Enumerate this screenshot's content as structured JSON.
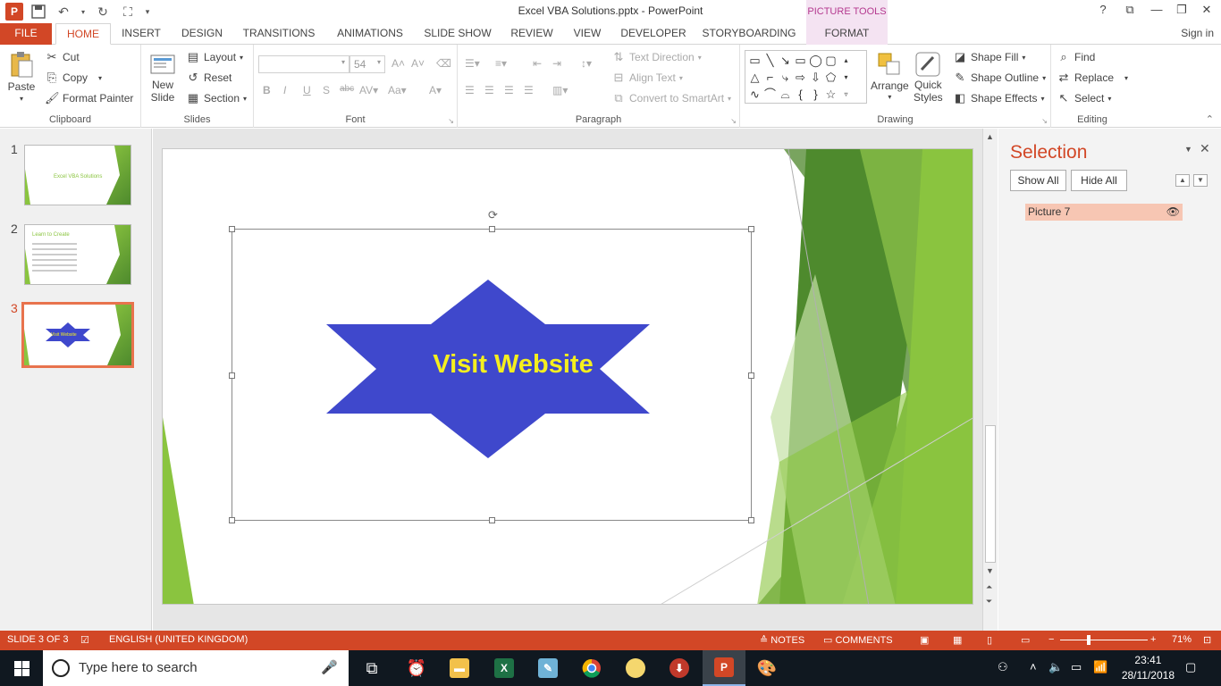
{
  "window": {
    "title": "Excel VBA Solutions.pptx - PowerPoint",
    "context_tab_group": "PICTURE TOOLS",
    "help": "?",
    "minimize": "—",
    "restore": "❐",
    "close": "✕",
    "ribbon_display": "⧉"
  },
  "tabs": [
    "FILE",
    "HOME",
    "INSERT",
    "DESIGN",
    "TRANSITIONS",
    "ANIMATIONS",
    "SLIDE SHOW",
    "REVIEW",
    "VIEW",
    "DEVELOPER",
    "STORYBOARDING",
    "FORMAT"
  ],
  "sign_in": "Sign in",
  "ribbon": {
    "clipboard": {
      "label": "Clipboard",
      "paste": "Paste",
      "cut": "Cut",
      "copy": "Copy",
      "format_painter": "Format Painter"
    },
    "slides": {
      "label": "Slides",
      "new_slide_1": "New",
      "new_slide_2": "Slide",
      "layout": "Layout",
      "reset": "Reset",
      "section": "Section"
    },
    "font": {
      "label": "Font",
      "size": "54"
    },
    "paragraph": {
      "label": "Paragraph",
      "text_direction": "Text Direction",
      "align_text": "Align Text",
      "convert_smartart": "Convert to SmartArt"
    },
    "drawing": {
      "label": "Drawing",
      "arrange": "Arrange",
      "quick_styles_1": "Quick",
      "quick_styles_2": "Styles",
      "shape_fill": "Shape Fill",
      "shape_outline": "Shape Outline",
      "shape_effects": "Shape Effects"
    },
    "editing": {
      "label": "Editing",
      "find": "Find",
      "replace": "Replace",
      "select": "Select"
    }
  },
  "thumbnails": [
    {
      "number": "1",
      "title": "Excel VBA Solutions"
    },
    {
      "number": "2",
      "title": "Learn to Create"
    },
    {
      "number": "3",
      "title": "Visit Website"
    }
  ],
  "slide": {
    "star_text": "Visit Website",
    "star_color": "#3f48cc",
    "text_color": "#f5ef1e"
  },
  "selection_pane": {
    "title": "Selection",
    "show_all": "Show All",
    "hide_all": "Hide All",
    "items": [
      {
        "name": "Picture 7"
      }
    ]
  },
  "status": {
    "slide_info": "SLIDE 3 OF 3",
    "language": "ENGLISH (UNITED KINGDOM)",
    "notes": "NOTES",
    "comments": "COMMENTS",
    "zoom": "71%"
  },
  "taskbar": {
    "search_placeholder": "Type here to search",
    "time": "23:41",
    "date": "28/11/2018"
  },
  "colors": {
    "accent": "#d24726",
    "format_tab_bg": "#f4e3f2",
    "slide_green": "#8ac43f",
    "dark_green": "#4e8a2d"
  }
}
